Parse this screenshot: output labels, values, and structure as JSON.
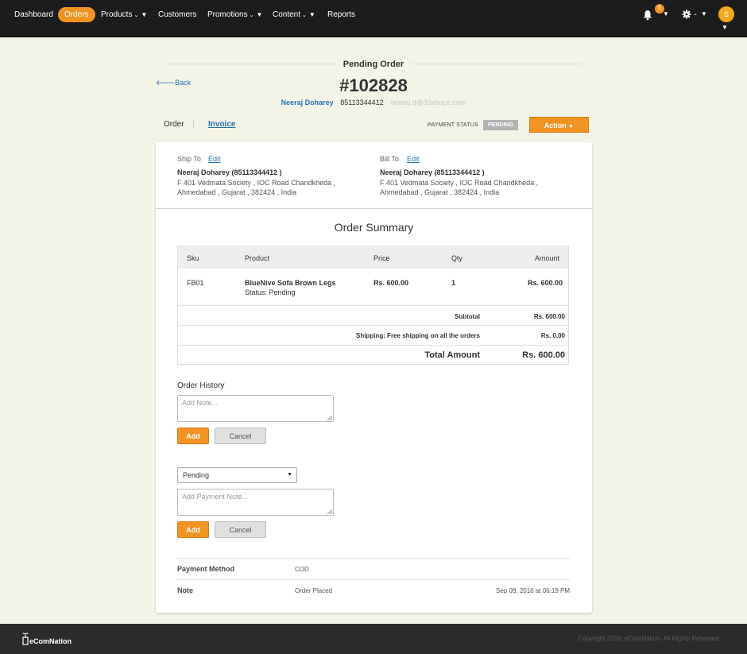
{
  "nav": {
    "items": [
      {
        "label": "Dashboard",
        "dropdown": false,
        "active": false
      },
      {
        "label": "Orders",
        "dropdown": false,
        "active": true
      },
      {
        "label": "Products",
        "dropdown": true,
        "active": false
      },
      {
        "label": "Customers",
        "dropdown": false,
        "active": false
      },
      {
        "label": "Promotions",
        "dropdown": true,
        "active": false
      },
      {
        "label": "Content",
        "dropdown": true,
        "active": false
      },
      {
        "label": "Reports",
        "dropdown": false,
        "active": false
      }
    ],
    "notification_count": "5",
    "avatar_initial": "S",
    "icons": [
      "bell-icon",
      "gear-icon"
    ]
  },
  "header": {
    "status_title": "Pending Order",
    "back_label": "Back",
    "order_number": "#102828",
    "customer_name": "Neeraj Doharey",
    "customer_phone": "85113344412",
    "customer_email": "neeraj.d@39shops.com",
    "tabs": {
      "order": "Order",
      "invoice": "Invoice"
    },
    "payment_status_label": "PAYMENT STATUS",
    "payment_status": "PENDING",
    "action_label": "Action"
  },
  "ship_to": {
    "label": "Ship To",
    "edit": "Edit",
    "name": "Neeraj Doharey (85113344412 )",
    "line1": "F 401 Vedmata Society , IOC Road Chandkheda ,",
    "line2": "Ahmedabad , Gujarat , 382424 , India"
  },
  "bill_to": {
    "label": "Bill To",
    "edit": "Edit",
    "name": "Neeraj Doharey (85113344412 )",
    "line1": "F 401 Vedmata Society , IOC Road Chandkheda ,",
    "line2": "Ahmedabad , Gujarat , 382424 , India"
  },
  "summary": {
    "title": "Order Summary",
    "columns": {
      "sku": "Sku",
      "product": "Product",
      "price": "Price",
      "qty": "Qty",
      "amount": "Amount"
    },
    "item": {
      "sku": "FB01",
      "product": "BlueNive Sofa Brown Legs",
      "status": "Status: Pending",
      "price": "Rs. 600.00",
      "qty": "1",
      "amount": "Rs. 600.00"
    },
    "subtotal_label": "Subtotal",
    "subtotal": "Rs. 600.00",
    "shipping_label": "Shipping:  Free shipping on all the orders",
    "shipping": "Rs. 0.00",
    "total_label": "Total Amount",
    "total": "Rs. 600.00"
  },
  "history": {
    "label": "Order History",
    "note_placeholder": "Add Note...",
    "add": "Add",
    "cancel": "Cancel"
  },
  "payment_form": {
    "selected": "Pending",
    "note_placeholder": "Add Payment Note...",
    "add": "Add",
    "cancel": "Cancel"
  },
  "info": {
    "method_label": "Payment Method",
    "method": "COD",
    "note_label": "Note",
    "note": "Order Placed",
    "note_date": "Sep 09, 2016 at 06:19 PM"
  },
  "footer": {
    "brand": "eComNation",
    "copyright": "Copyright 2016, eComNation. All Rights Reserved."
  },
  "colors": {
    "accent": "#f29323",
    "link": "#2673b5",
    "nav_bg": "#1c1c1c",
    "page_bg": "#f4f3e8"
  }
}
